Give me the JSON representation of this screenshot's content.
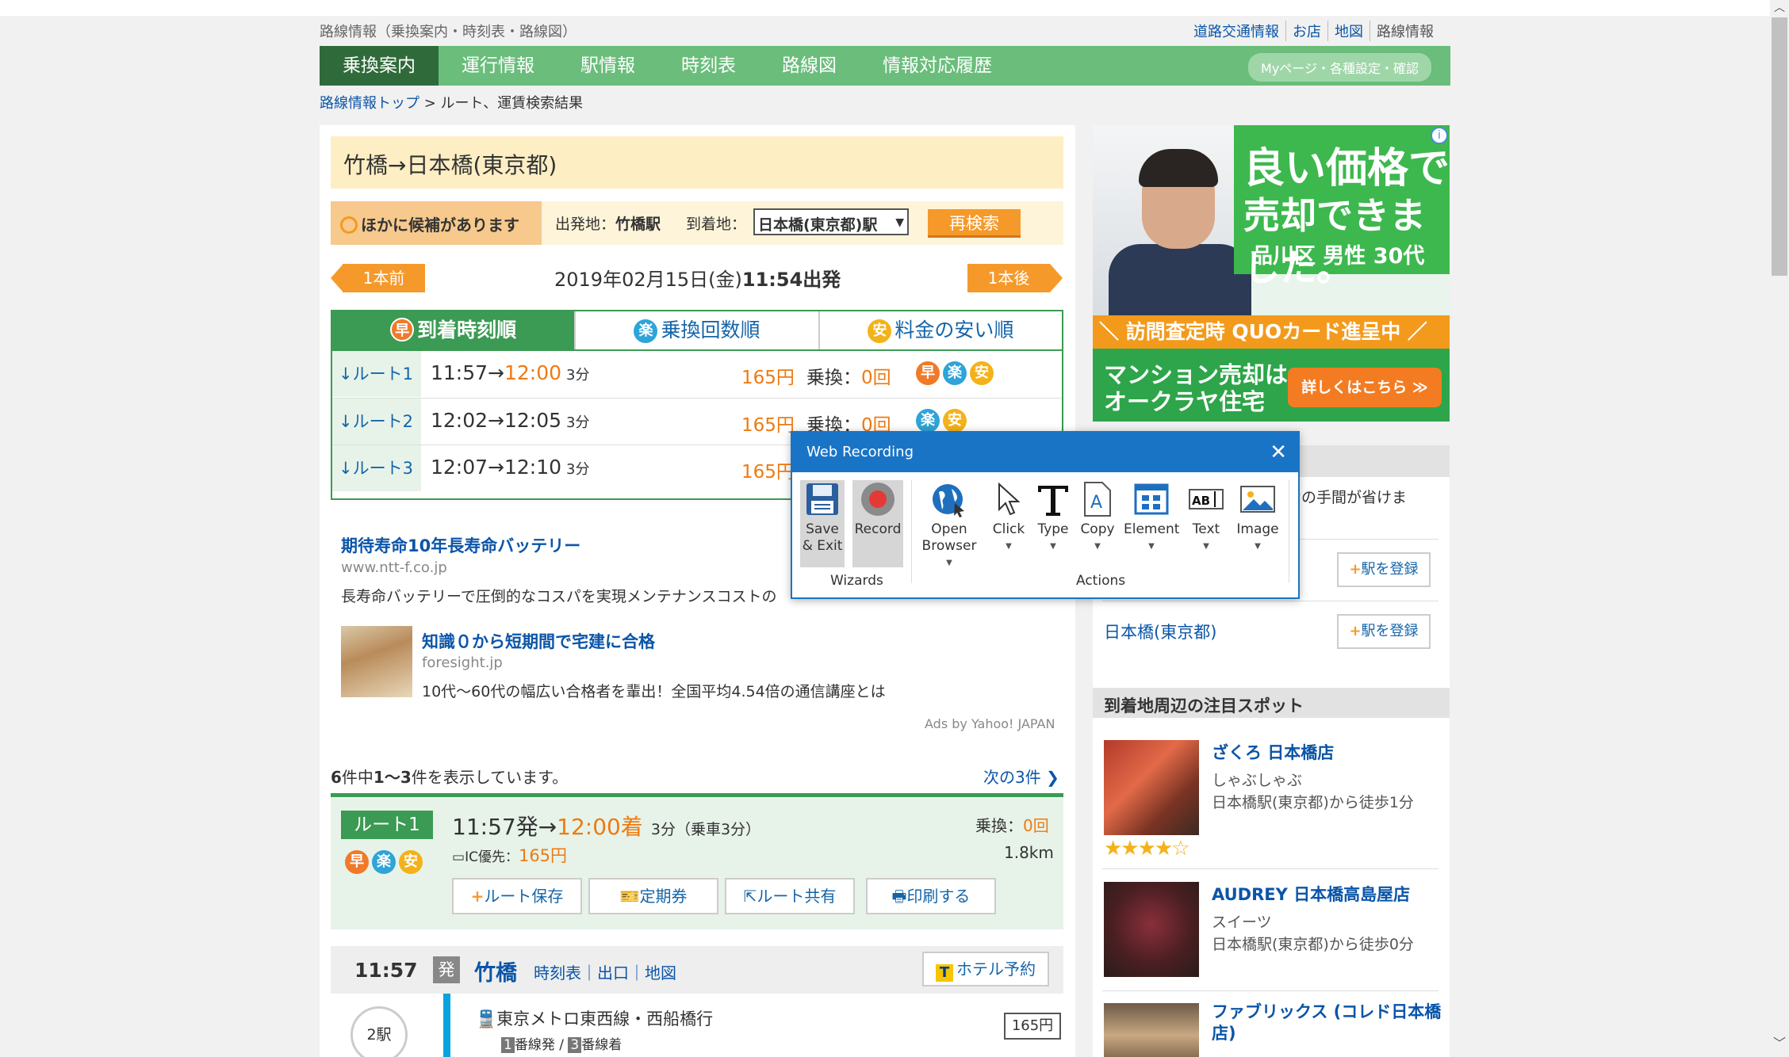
{
  "header": {
    "subtitle": "路線情報（乗換案内・時刻表・路線図）",
    "links": [
      "道路交通情報",
      "お店",
      "地図",
      "路線情報"
    ]
  },
  "nav": {
    "items": [
      "乗換案内",
      "運行情報",
      "駅情報",
      "時刻表",
      "路線図",
      "情報対応履歴"
    ],
    "mypage": "Myページ・各種設定・確認"
  },
  "breadcrumb": {
    "top": "路線情報トップ",
    "sep": " > ",
    "current": "ルート、運賃検索結果"
  },
  "search": {
    "title": "竹橋→日本橋(東京都)",
    "candidate": "ほかに候補があります",
    "dep_label": "出発地：",
    "dep_value": "竹橋駅",
    "arr_label": "到着地：",
    "arr_value": "日本橋(東京都)駅",
    "research": "再検索",
    "prev": "1本前",
    "next": "1本後",
    "date": "2019年02月15日(金)",
    "time": "11:54出発"
  },
  "tabs": [
    {
      "badge": "早",
      "label": "到着時刻順"
    },
    {
      "badge": "楽",
      "label": "乗換回数順"
    },
    {
      "badge": "安",
      "label": "料金の安い順"
    }
  ],
  "routes": [
    {
      "label": "↓ルート1",
      "dep": "11:57",
      "arrow": "→",
      "arr": "12:00",
      "dur": "3分",
      "fare": "165円",
      "xfer_label": "乗換：",
      "xfer": "0回"
    },
    {
      "label": "↓ルート2",
      "dep": "12:02",
      "arrow": "→",
      "arr": "12:05",
      "dur": "3分",
      "fare": "165円",
      "xfer_label": "乗換：",
      "xfer": "0回"
    },
    {
      "label": "↓ルート3",
      "dep": "12:07",
      "arrow": "→",
      "arr": "12:10",
      "dur": "3分",
      "fare": "165円",
      "xfer_label": "",
      "xfer": ""
    }
  ],
  "ads": [
    {
      "title": "期待寿命10年長寿命バッテリー",
      "url": "www.ntt-f.co.jp",
      "desc": "長寿命バッテリーで圧倒的なコスパを実現メンテナンスコストの"
    },
    {
      "title": "知識０から短期間で宅建に合格",
      "url": "foresight.jp",
      "desc": "10代～60代の幅広い合格者を輩出！全国平均4.54倍の通信講座とは"
    }
  ],
  "ads_by": "Ads by Yahoo! JAPAN",
  "results": {
    "total": "6",
    "t1": "件中",
    "range": "1～3",
    "t2": "件を表示しています。",
    "next": "次の3件"
  },
  "detail": {
    "label": "ルート1",
    "dep": "11:57発",
    "arrow": "→",
    "arr": "12:00着",
    "dur": "3分（乗車3分）",
    "ic_label": "IC優先：",
    "ic_fare": "165円",
    "xfer_label": "乗換：",
    "xfer": "0回",
    "distance": "1.8km",
    "buttons": [
      "ルート保存",
      "定期券",
      "ルート共有",
      "印刷する"
    ]
  },
  "station": {
    "time": "11:57",
    "tag": "発",
    "name": "竹橋",
    "links": "時刻表｜出口｜地図",
    "hotel": "ホテル予約",
    "stops": "2駅",
    "line": "東京メトロ東西線・西船橋行",
    "platform_a": "1",
    "platform_a_t": "番線発 / ",
    "platform_b": "3",
    "platform_b_t": "番線着",
    "fare": "165円"
  },
  "side_ad": {
    "h1": "良い価格で",
    "h2": "売却できました。",
    "sub": "品川区 男性 30代",
    "band": "＼ 訪問査定時 QUOカード進呈中 ／",
    "foot": "マンション売却は\nオークラヤ住宅",
    "cta": "詳しくはこちら ≫"
  },
  "side": {
    "tip": "入力の手間が省けま",
    "stations": [
      "日本橋(東京都)"
    ],
    "register": "駅を登録",
    "spots_title": "到着地周辺の注目スポット",
    "spots": [
      {
        "name": "ざくろ 日本橋店",
        "cat": "しゃぶしゃぶ",
        "dist": "日本橋駅(東京都)から徒歩1分"
      },
      {
        "name": "AUDREY 日本橋高島屋店",
        "cat": "スイーツ",
        "dist": "日本橋駅(東京都)から徒歩0分"
      },
      {
        "name": "ファブリックス (コレド日本橋店)",
        "cat": "",
        "dist": ""
      }
    ],
    "stars": "★★★★☆"
  },
  "dialog": {
    "title": "Web Recording",
    "tools": [
      {
        "label": "Save\n& Exit",
        "icon": "save-icon"
      },
      {
        "label": "Record",
        "icon": "record-icon"
      },
      {
        "label": "Open\nBrowser",
        "icon": "globe-icon"
      },
      {
        "label": "Click",
        "icon": "cursor-icon"
      },
      {
        "label": "Type",
        "icon": "type-icon"
      },
      {
        "label": "Copy",
        "icon": "copy-icon"
      },
      {
        "label": "Element",
        "icon": "element-icon"
      },
      {
        "label": "Text",
        "icon": "text-icon"
      },
      {
        "label": "Image",
        "icon": "image-icon"
      }
    ],
    "groups": [
      "Wizards",
      "Actions"
    ]
  },
  "colors": {
    "nav_green": "#6abd7b",
    "accent_orange": "#f59a2a",
    "link_blue": "#0b55a8",
    "dialog_blue": "#1a74c6"
  }
}
